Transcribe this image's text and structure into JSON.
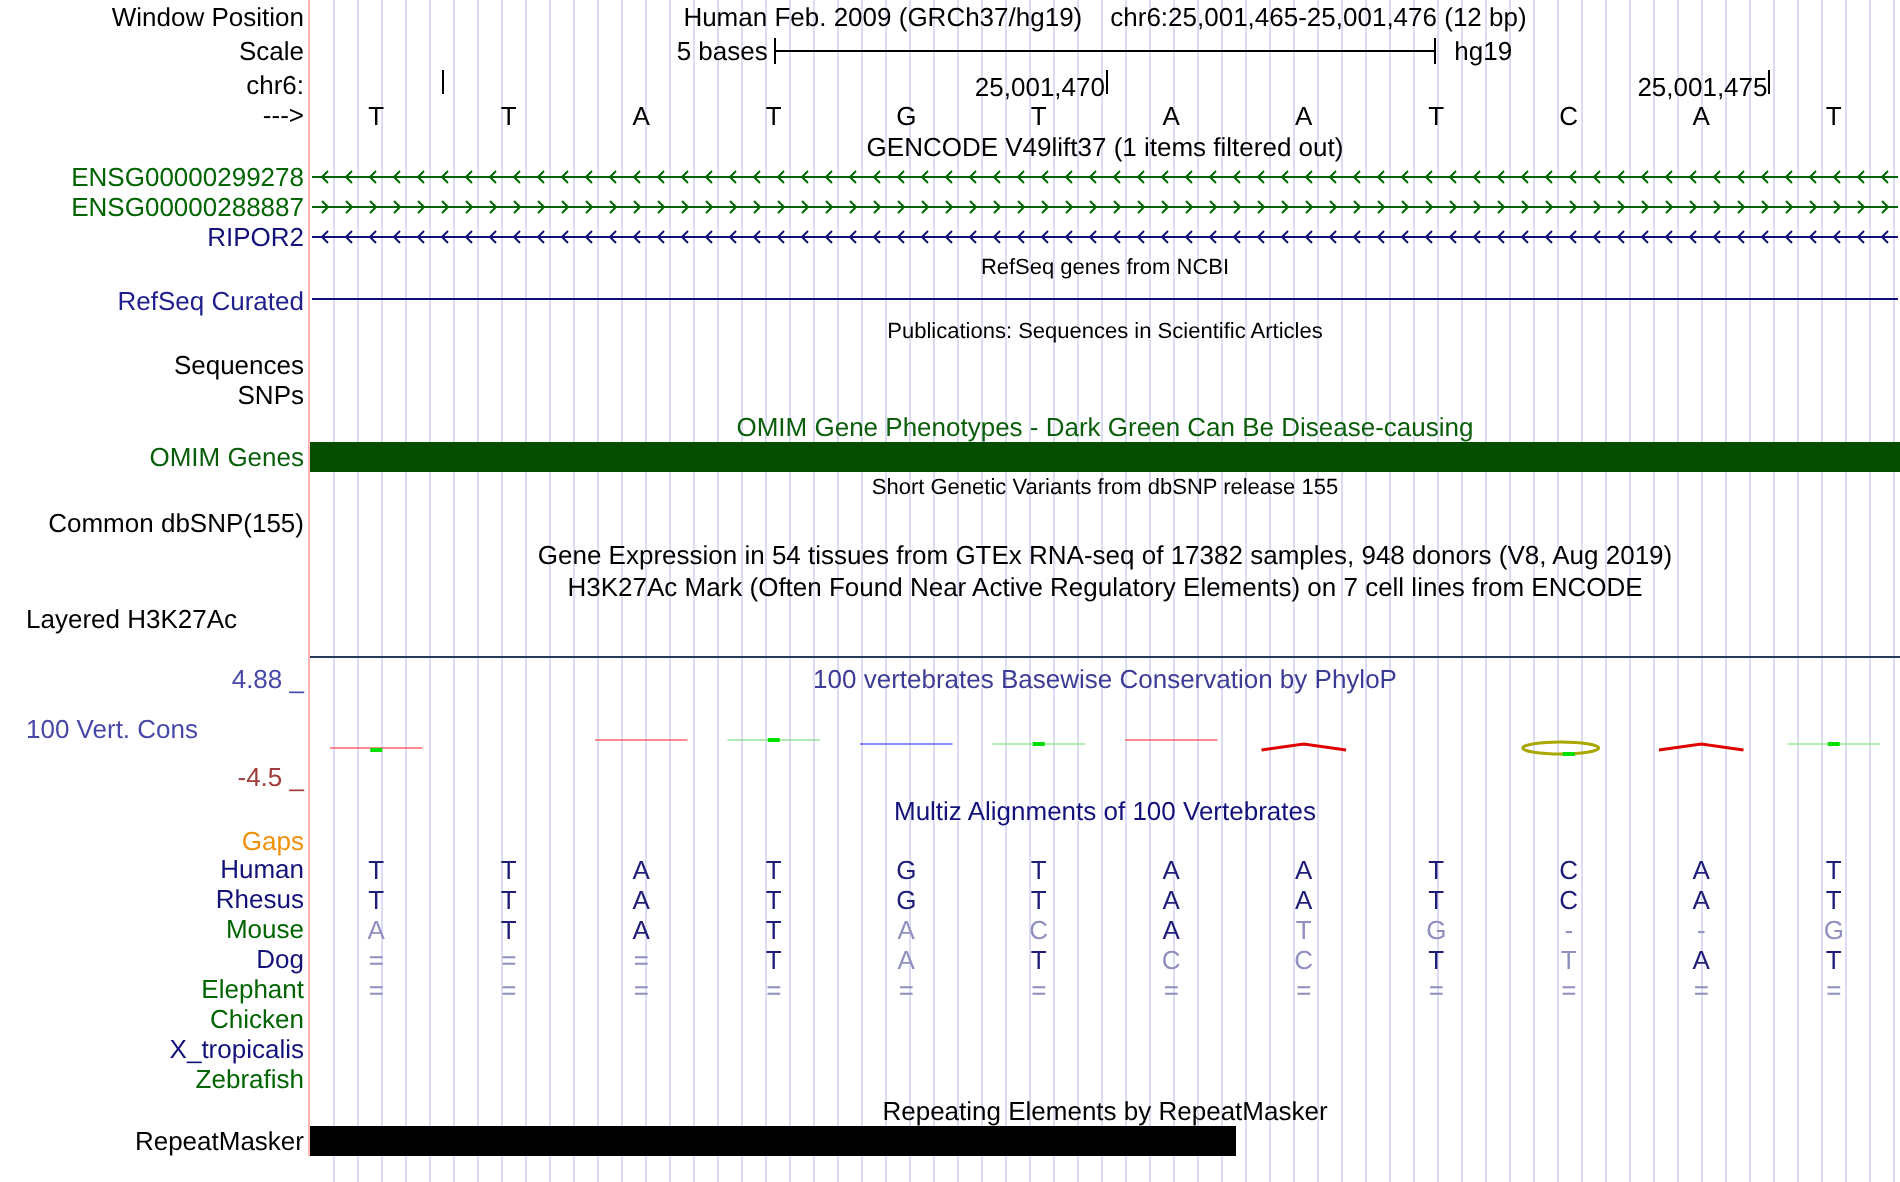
{
  "header": {
    "label": "Window Position",
    "assembly": "Human Feb. 2009 (GRCh37/hg19)",
    "position": "chr6:25,001,465-25,001,476 (12 bp)"
  },
  "scale": {
    "label": "Scale",
    "span": "5 bases",
    "assembly": "hg19"
  },
  "ruler": {
    "label": "chr6:",
    "ticks": [
      "25,001,470",
      "25,001,475"
    ]
  },
  "sequence": {
    "label": "--->",
    "bases": [
      "T",
      "T",
      "A",
      "T",
      "G",
      "T",
      "A",
      "A",
      "T",
      "C",
      "A",
      "T"
    ]
  },
  "tracks": [
    {
      "kind": "genes",
      "title": "GENCODE V49lift37 (1 items filtered out)",
      "items": [
        {
          "name": "ENSG00000299278",
          "color": "#006400",
          "reverse": true
        },
        {
          "name": "ENSG00000288887",
          "color": "#006400",
          "reverse": false
        },
        {
          "name": "RIPOR2",
          "color": "#12127a",
          "reverse": true
        }
      ]
    },
    {
      "kind": "dense_line",
      "title": "RefSeq genes from NCBI",
      "label": "RefSeq Curated"
    },
    {
      "kind": "note",
      "title": "Publications: Sequences in Scientific Articles",
      "labels": [
        "Sequences",
        "SNPs"
      ]
    },
    {
      "kind": "omim_bar",
      "title": "OMIM Gene Phenotypes - Dark Green Can Be Disease-causing",
      "label": "OMIM Genes"
    },
    {
      "kind": "note",
      "title": "Short Genetic Variants from dbSNP release 155",
      "labels": [
        "Common dbSNP(155)"
      ]
    },
    {
      "kind": "expression",
      "title": "Gene Expression in 54 tissues from GTEx RNA-seq of 17382 samples, 948 donors (V8, Aug 2019)"
    },
    {
      "kind": "layered",
      "title": "H3K27Ac Mark (Often Found Near Active Regulatory Elements) on 7 cell lines from ENCODE",
      "label": "Layered H3K27Ac"
    },
    {
      "kind": "wiggle",
      "title": "100 vertebrates Basewise Conservation by PhyloP",
      "label": "100 Vert. Cons",
      "max": "4.88 _",
      "min": "-4.5 _"
    },
    {
      "kind": "multiz",
      "title": "Multiz Alignments of 100 Vertebrates",
      "gaps_label": "Gaps",
      "species": [
        {
          "name": "Human",
          "color": "#12127a",
          "bases": [
            "T",
            "T",
            "A",
            "T",
            "G",
            "T",
            "A",
            "A",
            "T",
            "C",
            "A",
            "T"
          ],
          "matches": [
            true,
            true,
            true,
            true,
            true,
            true,
            true,
            true,
            true,
            true,
            true,
            true
          ]
        },
        {
          "name": "Rhesus",
          "color": "#12127a",
          "bases": [
            "T",
            "T",
            "A",
            "T",
            "G",
            "T",
            "A",
            "A",
            "T",
            "C",
            "A",
            "T"
          ],
          "matches": [
            true,
            true,
            true,
            true,
            true,
            true,
            true,
            true,
            true,
            true,
            true,
            true
          ]
        },
        {
          "name": "Mouse",
          "color": "#006400",
          "bases": [
            "A",
            "T",
            "A",
            "T",
            "A",
            "C",
            "A",
            "T",
            "G",
            "-",
            "-",
            "G"
          ],
          "matches": [
            false,
            true,
            true,
            true,
            false,
            false,
            true,
            false,
            false,
            false,
            false,
            false
          ]
        },
        {
          "name": "Dog",
          "color": "#12127a",
          "bases": [
            "=",
            "=",
            "=",
            "T",
            "A",
            "T",
            "C",
            "C",
            "T",
            "T",
            "A",
            "T"
          ],
          "matches": [
            false,
            false,
            false,
            true,
            false,
            true,
            false,
            false,
            true,
            false,
            true,
            true
          ]
        },
        {
          "name": "Elephant",
          "color": "#006400",
          "bases": [
            "=",
            "=",
            "=",
            "=",
            "=",
            "=",
            "=",
            "=",
            "=",
            "=",
            "=",
            "="
          ],
          "matches": [
            false,
            false,
            false,
            false,
            false,
            false,
            false,
            false,
            false,
            false,
            false,
            false
          ]
        },
        {
          "name": "Chicken",
          "color": "#006400"
        },
        {
          "name": "X_tropicalis",
          "color": "#12127a"
        },
        {
          "name": "Zebrafish",
          "color": "#006400"
        }
      ]
    },
    {
      "kind": "repeat_bar",
      "title": "Repeating Elements by RepeatMasker",
      "label": "RepeatMasker"
    }
  ]
}
